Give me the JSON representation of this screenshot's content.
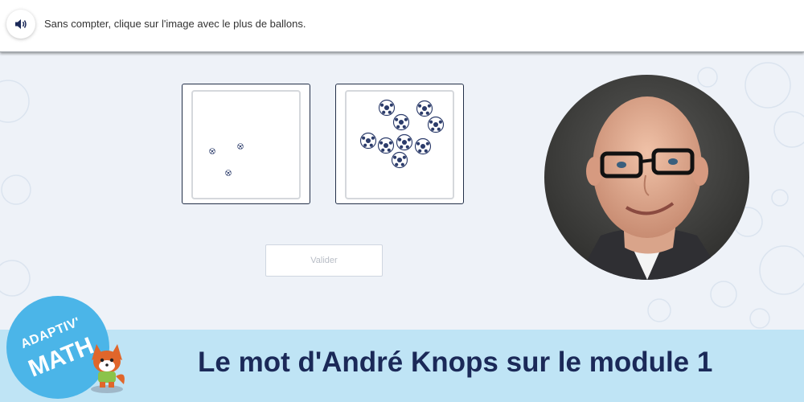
{
  "header": {
    "speaker_icon": "speaker-icon",
    "instruction": "Sans compter, clique sur l'image avec le plus de ballons."
  },
  "choices": [
    {
      "ball_count": 3
    },
    {
      "ball_count": 10
    }
  ],
  "validate_label": "Valider",
  "banner": {
    "title": "Le mot d'André Knops sur le module 1",
    "background": "#bfe4f5",
    "title_color": "#1b2958"
  },
  "logo": {
    "line1": "ADAPTIV'",
    "line2": "MATH",
    "color": "#4bb5e8"
  },
  "colors": {
    "page_bg": "#eef2f8",
    "card_border": "#233049"
  }
}
